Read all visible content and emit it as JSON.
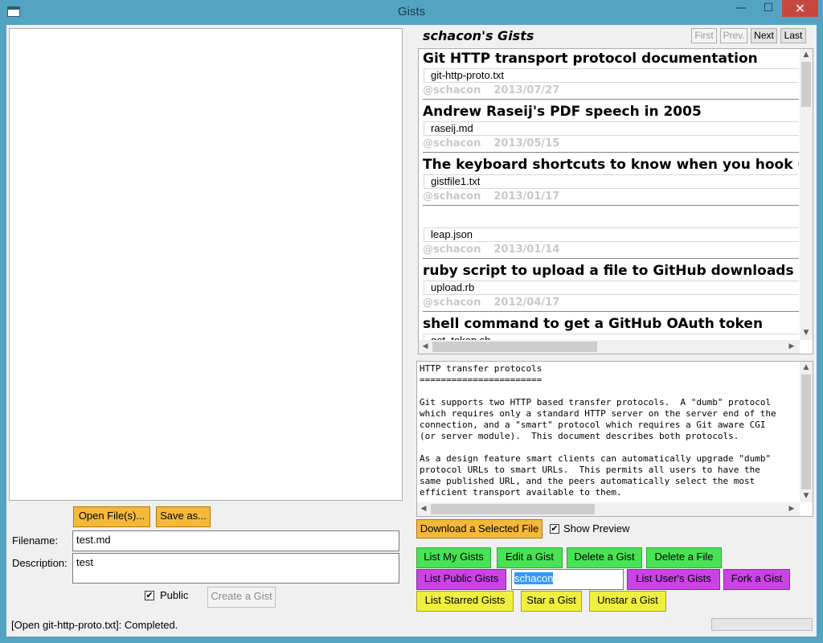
{
  "window": {
    "title": "Gists",
    "minimize": "—",
    "maximize": "☐",
    "close": "✕"
  },
  "left": {
    "open_files_label": "Open File(s)...",
    "save_as_label": "Save as...",
    "filename_label": "Filename:",
    "filename_value": "test.md",
    "description_label": "Description:",
    "description_value": "test",
    "public_label": "Public",
    "public_checked": "✔",
    "create_gist_label": "Create a Gist"
  },
  "gists": {
    "heading": "schacon's Gists",
    "nav": {
      "first": "First",
      "prev": "Prev.",
      "next": "Next",
      "last": "Last"
    },
    "items": [
      {
        "title": "Git HTTP transport protocol documentation",
        "file": "git-http-proto.txt",
        "user": "@schacon",
        "date": "2013/07/27"
      },
      {
        "title": "Andrew Raseij's PDF speech in 2005",
        "file": "raseij.md",
        "user": "@schacon",
        "date": "2013/05/15"
      },
      {
        "title": "The keyboard shortcuts to know when you hook up your",
        "file": "gistfile1.txt",
        "user": "@schacon",
        "date": "2013/01/17"
      },
      {
        "title": "",
        "file": "leap.json",
        "user": "@schacon",
        "date": "2013/01/14"
      },
      {
        "title": "ruby script to upload a file to GitHub downloads section",
        "file": "upload.rb",
        "user": "@schacon",
        "date": "2012/04/17"
      },
      {
        "title": "shell command to get a GitHub OAuth token",
        "file": "get_token.sh",
        "user": "",
        "date": ""
      }
    ]
  },
  "preview": {
    "text": "HTTP transfer protocols\n=======================\n\nGit supports two HTTP based transfer protocols.  A \"dumb\" protocol\nwhich requires only a standard HTTP server on the server end of the\nconnection, and a \"smart\" protocol which requires a Git aware CGI\n(or server module).  This document describes both protocols.\n\nAs a design feature smart clients can automatically upgrade \"dumb\"\nprotocol URLs to smart URLs.  This permits all users to have the\nsame published URL, and the peers automatically select the most\nefficient transport available to them."
  },
  "actions": {
    "download_label": "Download a Selected File",
    "show_preview_label": "Show Preview",
    "show_preview_checked": "✔",
    "list_my_gists": "List My Gists",
    "edit_gist": "Edit a Gist",
    "delete_gist": "Delete a Gist",
    "delete_file": "Delete a File",
    "list_public_gists": "List Public Gists",
    "user_input_value": "schacon",
    "list_users_gists": "List User's Gists",
    "fork_gist": "Fork a Gist",
    "list_starred_gists": "List Starred Gists",
    "star_gist": "Star a Gist",
    "unstar_gist": "Unstar a Gist"
  },
  "status": {
    "text": "[Open git-http-proto.txt]: Completed."
  },
  "colors": {
    "orange": "#f5b93a",
    "green": "#48e255",
    "purple": "#cb43e6",
    "yellow": "#eff03e",
    "titlebar": "#52a4c2",
    "close": "#c7463d"
  }
}
